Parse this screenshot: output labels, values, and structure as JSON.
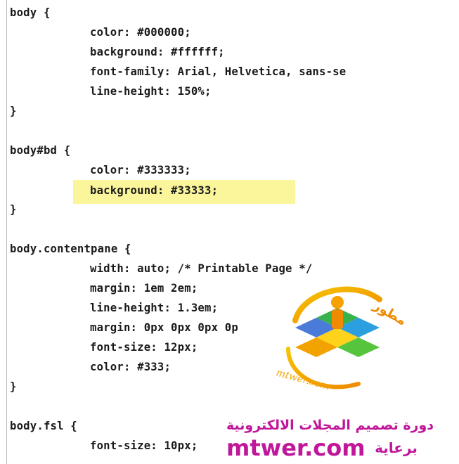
{
  "code_lines": [
    "body {",
    "color: #000000;",
    "background: #ffffff;",
    "font-family: Arial, Helvetica, sans-se",
    "line-height: 150%;",
    "}",
    "",
    "body#bd {",
    "color: #333333;",
    "background: #33333;",
    "}",
    "",
    "body.contentpane {",
    "width: auto; /* Printable Page */",
    "margin: 1em 2em;",
    "line-height: 1.3em;",
    "margin: 0px 0px 0px 0p",
    "font-size: 12px;",
    "color: #333;",
    "}",
    "",
    "body.fsl {",
    "font-size: 10px;"
  ],
  "highlight_color": "#fbf69c",
  "watermark": {
    "logo_text_top": "مطور",
    "logo_text_bottom": "mtwer.com",
    "course_title": "دورة تصميم المجلات الالكترونية",
    "sponsor_label": "برعاية",
    "domain": "mtwer.com",
    "brand_color": "#c0179a"
  }
}
